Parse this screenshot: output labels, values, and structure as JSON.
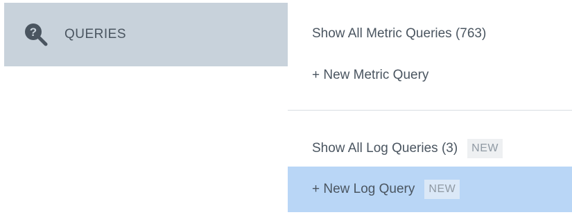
{
  "sidebar": {
    "active_item": {
      "icon": "question-search-icon",
      "label": "QUERIES"
    }
  },
  "menu": {
    "items": [
      {
        "label": "Show All Metric Queries (763)"
      },
      {
        "label": "+ New Metric Query"
      },
      {
        "label": "Show All Log Queries (3)",
        "badge": "NEW"
      },
      {
        "label": "+ New Log Query",
        "badge": "NEW"
      }
    ]
  },
  "colors": {
    "sidebar_active_bg": "#c8d2db",
    "menu_highlight_bg": "#b9d6f6",
    "text": "#4a5560",
    "badge_text": "#8f99a3"
  }
}
